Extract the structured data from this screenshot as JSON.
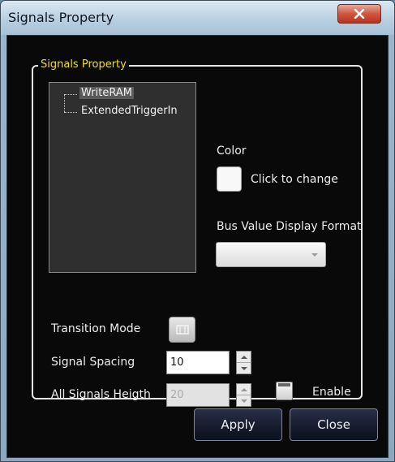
{
  "window": {
    "title": "Signals Property",
    "close_icon": "x-icon"
  },
  "group": {
    "label": "Signals Property"
  },
  "signals_tree": {
    "items": [
      {
        "label": "WriteRAM",
        "selected": true
      },
      {
        "label": "ExtendedTriggerIn",
        "selected": false
      }
    ]
  },
  "color_section": {
    "label": "Color",
    "swatch_color": "#ffffff",
    "change_label": "Click to change"
  },
  "bus_format": {
    "label": "Bus Value Display Format",
    "selected_value": "",
    "arrow_icon": "chevron-down-icon"
  },
  "transition_mode": {
    "label": "Transition Mode",
    "button_icon": "transition-icon"
  },
  "signal_spacing": {
    "label": "Signal Spacing",
    "value": "10"
  },
  "all_signals_height": {
    "label": "All Signals Heigth",
    "value": "20",
    "enabled": false
  },
  "enable": {
    "label": "Enable",
    "checked": false
  },
  "buttons": {
    "apply": "Apply",
    "close": "Close"
  },
  "colors": {
    "group_label": "#f0e010",
    "background": "#090909"
  }
}
